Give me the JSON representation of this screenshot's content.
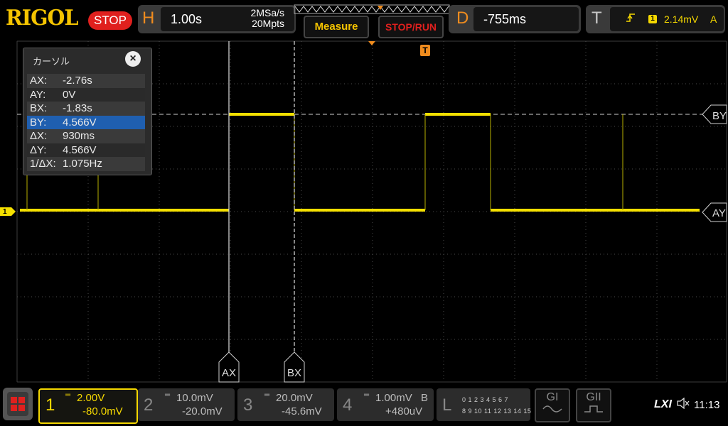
{
  "brand": "RIGOL",
  "run_state": "STOP",
  "horizontal": {
    "letter": "H",
    "timebase": "1.00s",
    "sample_rate": "2MSa/s",
    "memory_depth": "20Mpts"
  },
  "buttons": {
    "measure": "Measure",
    "stop_run": "STOP/RUN"
  },
  "delay": {
    "letter": "D",
    "value": "-755ms"
  },
  "trigger": {
    "letter": "T",
    "channel": "1",
    "level": "2.14mV",
    "mode": "A"
  },
  "trigger_position_marker": "T",
  "cursor_window": {
    "title": "カーソル",
    "close": "×",
    "rows": [
      {
        "label": "AX:",
        "value": "-2.76s"
      },
      {
        "label": "AY:",
        "value": "0V"
      },
      {
        "label": "BX:",
        "value": "-1.83s"
      },
      {
        "label": "BY:",
        "value": "4.566V"
      },
      {
        "label": "ΔX:",
        "value": "930ms"
      },
      {
        "label": "ΔY:",
        "value": "4.566V"
      },
      {
        "label": "1/ΔX:",
        "value": "1.075Hz"
      }
    ],
    "selected_row": 3
  },
  "cursor_labels": {
    "ax": "AX",
    "bx": "BX",
    "ay": "AY",
    "by": "BY"
  },
  "channel1_marker": "1",
  "channels": [
    {
      "num": "1",
      "scale": "2.00V",
      "offset": "-80.0mV",
      "color": "#f5d800",
      "active": true
    },
    {
      "num": "2",
      "scale": "10.0mV",
      "offset": "-20.0mV",
      "color": "#888888",
      "active": false
    },
    {
      "num": "3",
      "scale": "20.0mV",
      "offset": "-45.6mV",
      "color": "#888888",
      "active": false
    },
    {
      "num": "4",
      "scale": "1.00mV",
      "bw": "B",
      "offset": "+480uV",
      "color": "#888888",
      "active": false
    }
  ],
  "logic": {
    "letter": "L",
    "row1": "0 1 2 3  4 5 6 7",
    "row2": "8 9 10 11 12 13 14 15"
  },
  "generators": [
    "GI",
    "GII"
  ],
  "lxi": "LXI",
  "clock": "11:13",
  "colors": {
    "ch1": "#f5d800",
    "accent": "#f08c1e",
    "stop": "#e0201e",
    "selected": "#1f5fb0"
  }
}
